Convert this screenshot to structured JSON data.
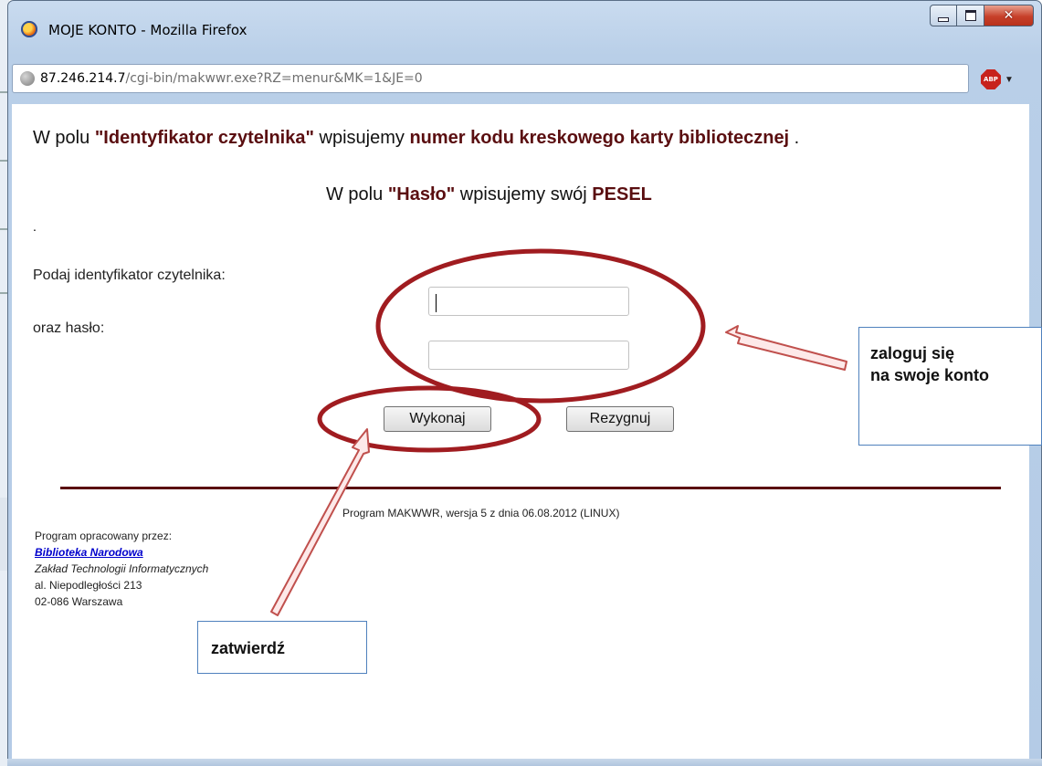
{
  "window": {
    "title": "MOJE KONTO - Mozilla Firefox",
    "url_host": "87.246.214.7",
    "url_path": "/cgi-bin/makwwr.exe?RZ=menur&MK=1&JE=0",
    "addon_label": "ABP"
  },
  "instructions": {
    "line1_prefix": "W polu ",
    "line1_field": "\"Identyfikator czytelnika\"",
    "line1_middle": " wpisujemy ",
    "line1_value": "numer kodu kreskowego karty bibliotecznej",
    "line1_suffix": " .",
    "line2_prefix": "W polu ",
    "line2_field": "\"Hasło\"",
    "line2_middle": " wpisujemy swój ",
    "line2_value": "PESEL",
    "dot": "."
  },
  "form": {
    "id_label": "Podaj identyfikator czytelnika:",
    "password_label": "oraz hasło:",
    "id_value": "",
    "password_value": "",
    "submit_label": "Wykonaj",
    "cancel_label": "Rezygnuj"
  },
  "footer": {
    "program_info": "Program MAKWWR, wersja 5 z dnia 06.08.2012 (LINUX)",
    "developed_by": "Program opracowany przez:",
    "library_link": "Biblioteka Narodowa",
    "department": "Zakład Technologii Informatycznych",
    "address1": "al. Niepodległości 213",
    "address2": "02-086 Warszawa"
  },
  "annotations": {
    "login_callout_line1": "zaloguj się",
    "login_callout_line2": "na swoje konto",
    "submit_callout": "zatwierdź",
    "ellipse_color": "#a01c20",
    "arrow_color": "#c0504d",
    "callout_border": "#4f81bd"
  }
}
